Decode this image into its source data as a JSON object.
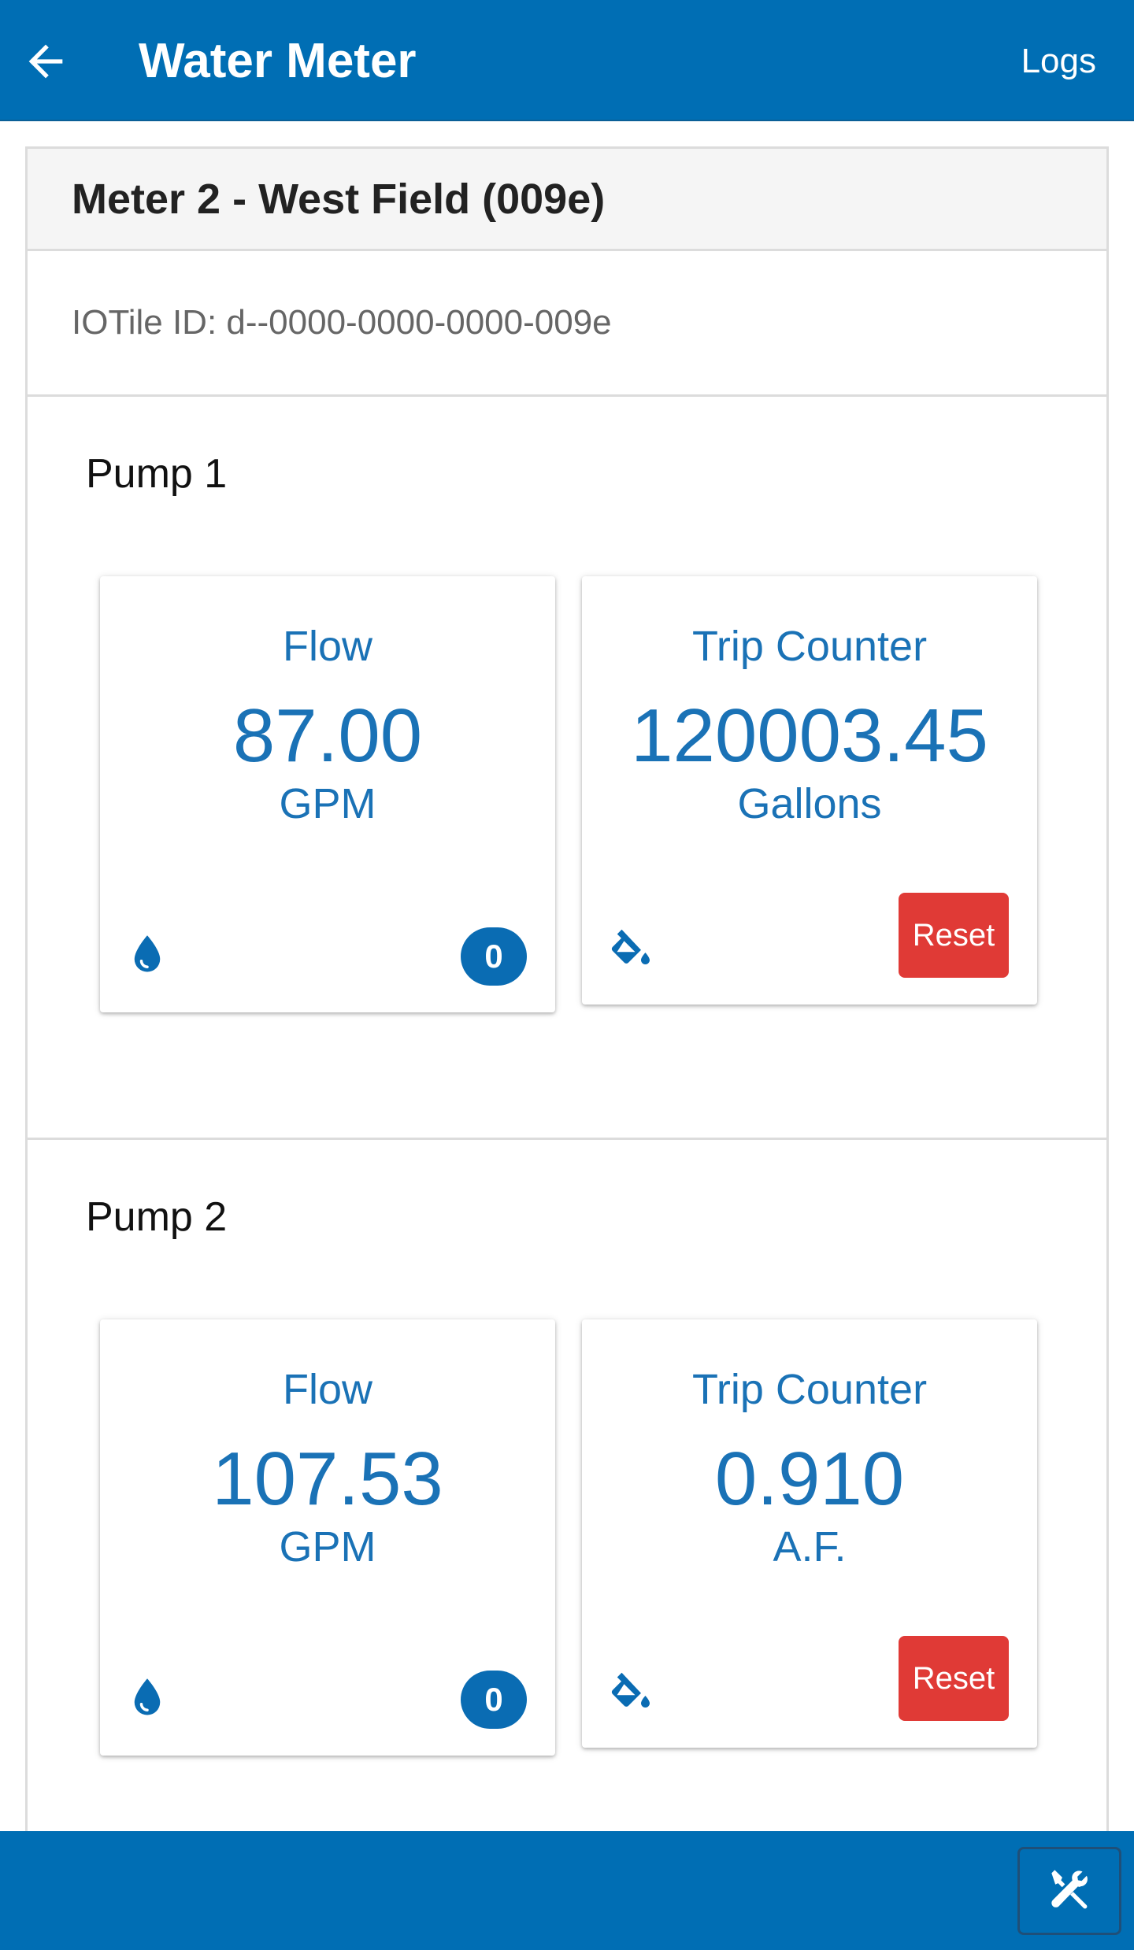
{
  "header": {
    "title": "Water Meter",
    "logs_label": "Logs",
    "back_icon": "arrow-left-icon"
  },
  "meter": {
    "title": "Meter 2 - West Field (009e)",
    "device_id": "IOTile ID: d--0000-0000-0000-009e"
  },
  "pumps": [
    {
      "name": "Pump 1",
      "flow": {
        "title": "Flow",
        "value": "87.00",
        "unit": "GPM",
        "icon": "water-drop-icon",
        "badge": "0"
      },
      "trip": {
        "title": "Trip Counter",
        "value": "120003.45",
        "unit": "Gallons",
        "icon": "paint-bucket-icon",
        "reset_label": "Reset"
      }
    },
    {
      "name": "Pump 2",
      "flow": {
        "title": "Flow",
        "value": "107.53",
        "unit": "GPM",
        "icon": "water-drop-icon",
        "badge": "0"
      },
      "trip": {
        "title": "Trip Counter",
        "value": "0.910",
        "unit": "A.F.",
        "icon": "paint-bucket-icon",
        "reset_label": "Reset"
      }
    }
  ],
  "footer": {
    "tools_icon": "tools-icon"
  },
  "colors": {
    "primary": "#006eb4",
    "accent_text": "#1a72b6",
    "reset": "#e03a36"
  }
}
